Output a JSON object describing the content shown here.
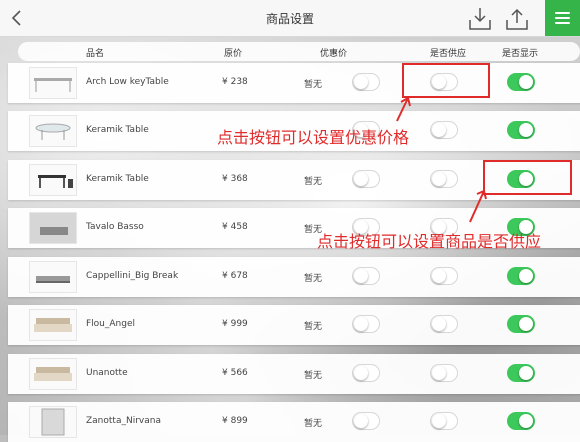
{
  "topbar": {
    "title": "商品设置"
  },
  "colors": {
    "accent_green": "#35b44a",
    "toggle_on": "#3cc85a",
    "annotation_red": "#e02b2b"
  },
  "header": {
    "name": "品名",
    "price": "原价",
    "discount": "优惠价",
    "supply": "是否供应",
    "display": "是否显示"
  },
  "rows": [
    {
      "name": "Arch Low keyTable",
      "price": "¥ 238",
      "discount": "暂无",
      "discount_on": false,
      "supply_on": false,
      "display_on": true,
      "thumb": "table-icon"
    },
    {
      "name": "Keramik Table",
      "price": "",
      "discount": "",
      "discount_on": false,
      "supply_on": false,
      "display_on": true,
      "thumb": "glass-table-icon"
    },
    {
      "name": "Keramik Table",
      "price": "¥ 368",
      "discount": "暂无",
      "discount_on": false,
      "supply_on": false,
      "display_on": true,
      "thumb": "desk-set-icon"
    },
    {
      "name": "Tavalo Basso",
      "price": "¥ 458",
      "discount": "暂无",
      "discount_on": false,
      "supply_on": false,
      "display_on": true,
      "thumb": "room-icon"
    },
    {
      "name": "Cappellini_Big Break",
      "price": "¥ 678",
      "discount": "暂无",
      "discount_on": false,
      "supply_on": false,
      "display_on": true,
      "thumb": "low-table-icon"
    },
    {
      "name": "Flou_Angel",
      "price": "¥ 999",
      "discount": "暂无",
      "discount_on": false,
      "supply_on": false,
      "display_on": true,
      "thumb": "bed-icon"
    },
    {
      "name": "Unanotte",
      "price": "¥ 566",
      "discount": "暂无",
      "discount_on": false,
      "supply_on": false,
      "display_on": true,
      "thumb": "bed-icon"
    },
    {
      "name": "Zanotta_Nirvana",
      "price": "¥ 899",
      "discount": "暂无",
      "discount_on": false,
      "supply_on": false,
      "display_on": true,
      "thumb": "cabinet-icon"
    }
  ],
  "annotations": {
    "discount_hint": "点击按钮可以设置优惠价格",
    "supply_hint": "点击按钮可以设置商品是否供应"
  }
}
